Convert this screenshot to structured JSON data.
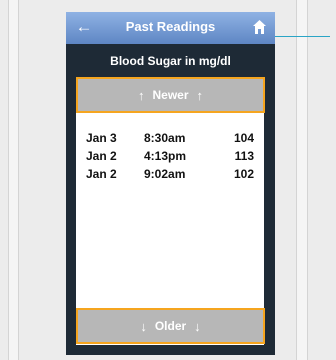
{
  "header": {
    "title": "Past Readings",
    "back_icon": "back-arrow-icon",
    "home_icon": "home-icon"
  },
  "subtitle": "Blood Sugar in mg/dl",
  "nav": {
    "newer_label": "Newer",
    "older_label": "Older"
  },
  "readings": [
    {
      "date": "Jan 3",
      "time": "8:30am",
      "value": "104"
    },
    {
      "date": "Jan 2",
      "time": "4:13pm",
      "value": "113"
    },
    {
      "date": "Jan 2",
      "time": "9:02am",
      "value": "102"
    }
  ],
  "colors": {
    "accent": "#f5a51f",
    "titlebar": "#7aa0d6",
    "annotation": "#2aa5c6"
  }
}
